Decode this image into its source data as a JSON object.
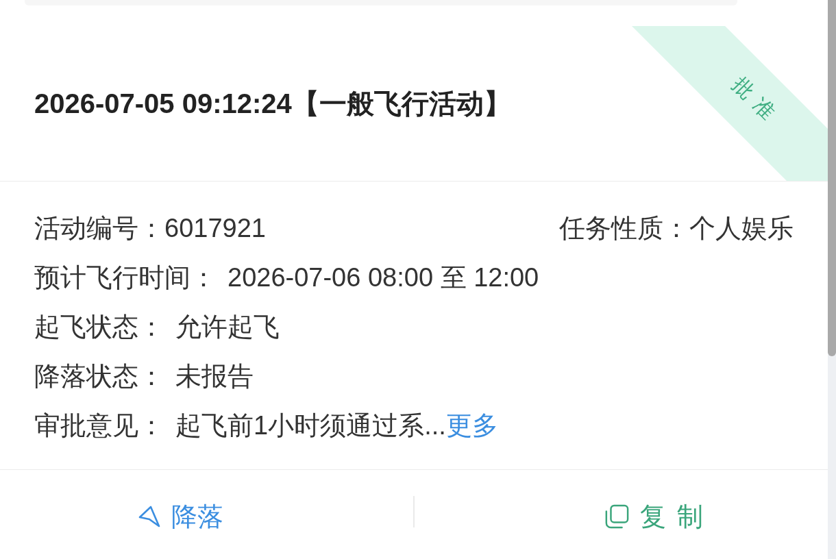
{
  "card": {
    "title": "2026-07-05 09:12:24【一般飞行活动】",
    "status": {
      "label": "批准",
      "kind": "approved"
    },
    "rows": [
      {
        "kind": "pair",
        "fields": [
          {
            "label": "活动编号：",
            "value": "6017921"
          },
          {
            "label": "任务性质：",
            "value": "个人娱乐"
          }
        ]
      },
      {
        "kind": "single",
        "fields": [
          {
            "label": "预计飞行时间：",
            "value": "2026-07-06 08:00 至 12:00"
          }
        ]
      },
      {
        "kind": "single",
        "fields": [
          {
            "label": "起飞状态：",
            "value": "允许起飞"
          }
        ]
      },
      {
        "kind": "single",
        "fields": [
          {
            "label": "降落状态：",
            "value": "未报告"
          }
        ]
      },
      {
        "kind": "single",
        "fields": [
          {
            "label": "审批意见：",
            "value": "起飞前1小时须通过系...",
            "link": "更多"
          }
        ]
      }
    ],
    "actions": [
      {
        "label": "降落",
        "kind": "land"
      },
      {
        "label": "复制",
        "kind": "copy"
      }
    ]
  }
}
